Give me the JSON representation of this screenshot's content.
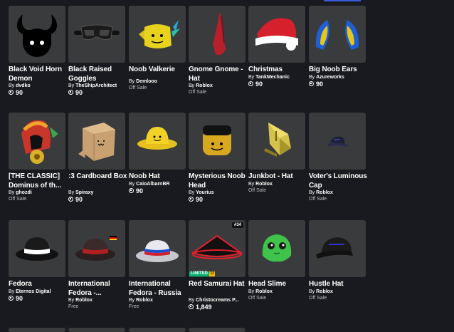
{
  "items": [
    {
      "name": "Black Void Horn Demon",
      "by": "By",
      "creator": "dvdko",
      "price": "90",
      "status": "",
      "icon": "black-horn-demon-icon"
    },
    {
      "name": "Black Raised Goggles",
      "by": "By",
      "creator": "TheShipArchitect",
      "price": "90",
      "status": "",
      "icon": "goggles-icon"
    },
    {
      "name": "Noob Valkerie",
      "by": "By",
      "creator": "Demlooo",
      "price": "",
      "status": "Off Sale",
      "tilde": "~",
      "icon": "noob-valkyrie-icon"
    },
    {
      "name": "Gnome Gnome - Hat",
      "by": "By",
      "creator": "Roblox",
      "price": "",
      "status": "Off Sale",
      "icon": "gnome-hat-icon"
    },
    {
      "name": "Christmas",
      "by": "By",
      "creator": "TankMechanic",
      "price": "90",
      "status": "",
      "icon": "santa-hat-icon"
    },
    {
      "name": "Big Noob Ears",
      "by": "By",
      "creator": "Azureworks",
      "price": "90",
      "status": "",
      "icon": "noob-ears-icon"
    },
    {
      "name": "[THE CLASSIC] Dominus of th...",
      "by": "By",
      "creator": "ghozdi",
      "price": "",
      "status": "Off Sale",
      "tilde": "~",
      "icon": "dominus-icon"
    },
    {
      "name": ":3 Cardboard Box",
      "by": "By",
      "creator": "Spiraxy",
      "price": "90",
      "status": "",
      "icon": "cardboard-box-icon"
    },
    {
      "name": "Noob Hat",
      "by": "By",
      "creator": "CaioAlbarnBR",
      "price": "90",
      "status": "",
      "icon": "yellow-bucket-hat-icon"
    },
    {
      "name": "Mysterious Noob Head",
      "by": "By",
      "creator": "Yourius",
      "price": "90",
      "status": "",
      "icon": "noob-head-icon"
    },
    {
      "name": "Junkbot - Hat",
      "by": "By",
      "creator": "Roblox",
      "price": "",
      "status": "Off Sale",
      "icon": "junkbot-hat-icon"
    },
    {
      "name": "Voter's Luminous Cap",
      "by": "By",
      "creator": "Roblox",
      "price": "",
      "status": "Off Sale",
      "icon": "voter-cap-icon"
    },
    {
      "name": "Fedora",
      "by": "By",
      "creator": "Eternos Digital",
      "price": "90",
      "status": "",
      "icon": "fedora-icon"
    },
    {
      "name": "International Fedora -...",
      "by": "By",
      "creator": "Roblox",
      "price": "",
      "status": "Free",
      "icon": "germany-fedora-icon"
    },
    {
      "name": "International Fedora - Russia",
      "by": "By",
      "creator": "Roblox",
      "price": "",
      "status": "Free",
      "icon": "russia-fedora-icon"
    },
    {
      "name": "Red Samurai Hat",
      "by": "By",
      "creator": "Christocreams P...",
      "price": "1,849",
      "status": "",
      "serial": "#34",
      "limited": "LIMITED",
      "limited_u": "U",
      "icon": "samurai-hat-icon"
    },
    {
      "name": "Head Slime",
      "by": "By",
      "creator": "Roblox",
      "price": "",
      "status": "Off Sale",
      "icon": "head-slime-icon"
    },
    {
      "name": "Hustle Hat",
      "by": "By",
      "creator": "Roblox",
      "price": "",
      "status": "Off Sale",
      "icon": "hustle-cap-icon"
    }
  ],
  "colors": {
    "background": "#191a1f",
    "card": "#393b3d",
    "limited": "#00b06f",
    "unique": "#f6b702"
  }
}
